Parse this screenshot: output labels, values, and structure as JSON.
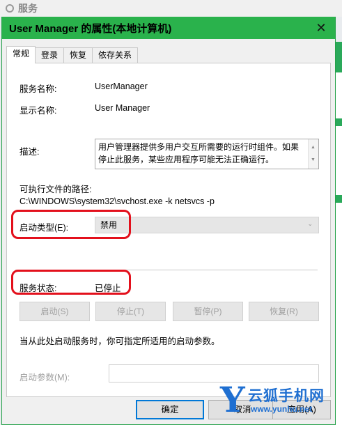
{
  "background_window": {
    "title": "服务"
  },
  "dialog": {
    "title": "User Manager 的属性(本地计算机)"
  },
  "tabs": [
    {
      "label": "常规",
      "active": true
    },
    {
      "label": "登录",
      "active": false
    },
    {
      "label": "恢复",
      "active": false
    },
    {
      "label": "依存关系",
      "active": false
    }
  ],
  "general": {
    "service_name_label": "服务名称:",
    "service_name": "UserManager",
    "display_name_label": "显示名称:",
    "display_name": "User Manager",
    "description_label": "描述:",
    "description": "用户管理器提供多用户交互所需要的运行时组件。如果停止此服务，某些应用程序可能无法正确运行。",
    "path_label": "可执行文件的路径:",
    "path": "C:\\WINDOWS\\system32\\svchost.exe -k netsvcs -p",
    "startup_type_label": "启动类型(E):",
    "startup_type": "禁用",
    "status_label": "服务状态:",
    "status": "已停止",
    "buttons": {
      "start": "启动(S)",
      "stop": "停止(T)",
      "pause": "暂停(P)",
      "resume": "恢复(R)"
    },
    "hint": "当从此处启动服务时，你可指定所适用的启动参数。",
    "start_params_label": "启动参数(M):",
    "start_params_value": ""
  },
  "footer": {
    "ok": "确定",
    "cancel": "取消",
    "apply": "应用(A)"
  },
  "watermark": {
    "letter": "Y",
    "text": "云狐手机网",
    "url": "www.yunhu.net"
  },
  "colors": {
    "titlebar": "#2ab24c",
    "highlight": "#e3101c",
    "watermark": "#1f6fd1"
  }
}
